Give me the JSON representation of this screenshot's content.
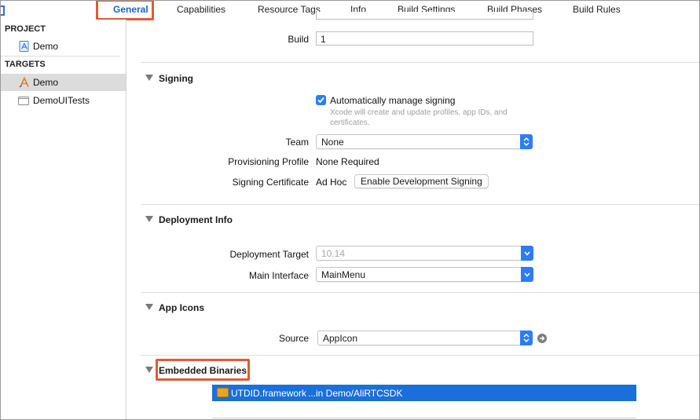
{
  "tabs": [
    {
      "label": "General",
      "active": true
    },
    {
      "label": "Capabilities"
    },
    {
      "label": "Resource Tags"
    },
    {
      "label": "Info"
    },
    {
      "label": "Build Settings"
    },
    {
      "label": "Build Phases"
    },
    {
      "label": "Build Rules"
    }
  ],
  "sidebar": {
    "project_header": "PROJECT",
    "project_items": [
      {
        "label": "Demo",
        "icon": "xcode-project-icon"
      }
    ],
    "targets_header": "TARGETS",
    "target_items": [
      {
        "label": "Demo",
        "icon": "app-target-icon",
        "selected": true
      },
      {
        "label": "DemoUITests",
        "icon": "folder-icon"
      }
    ]
  },
  "identity": {
    "build_label": "Build",
    "build_value": "1"
  },
  "signing": {
    "title": "Signing",
    "auto_manage_label": "Automatically manage signing",
    "auto_manage_checked": true,
    "auto_manage_help": "Xcode will create and update profiles, app IDs, and certificates.",
    "team_label": "Team",
    "team_value": "None",
    "provisioning_label": "Provisioning Profile",
    "provisioning_value": "None Required",
    "certificate_label": "Signing Certificate",
    "certificate_value": "Ad Hoc",
    "enable_dev_button": "Enable Development Signing"
  },
  "deployment": {
    "title": "Deployment Info",
    "target_label": "Deployment Target",
    "target_value": "10.14",
    "interface_label": "Main Interface",
    "interface_value": "MainMenu"
  },
  "app_icons": {
    "title": "App Icons",
    "source_label": "Source",
    "source_value": "AppIcon"
  },
  "embedded": {
    "title": "Embedded Binaries",
    "items": [
      {
        "name": "UTDID.framework",
        "path": "...in Demo/AliRTCSDK"
      }
    ]
  },
  "colors": {
    "accent": "#2d7cf6",
    "highlight_box": "#e05a3a",
    "selection": "#1b6fd8"
  }
}
